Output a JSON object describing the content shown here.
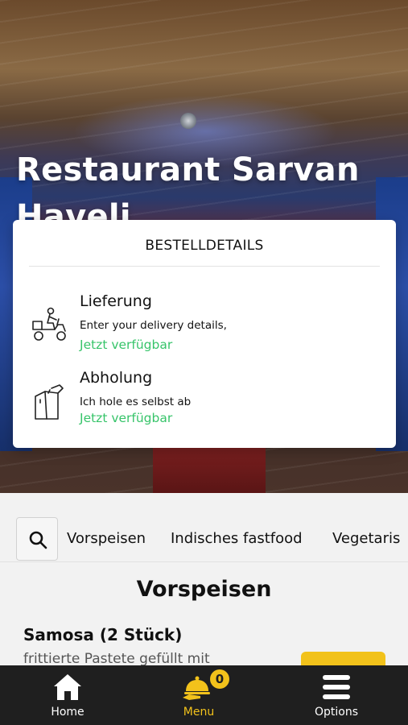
{
  "restaurant": {
    "name": "Restaurant Sarvan Haveli"
  },
  "order_modal": {
    "title": "BESTELLDETAILS",
    "options": [
      {
        "title": "Lieferung",
        "description": "Enter your delivery details,",
        "status": "Jetzt verfügbar",
        "icon": "delivery-scooter-icon"
      },
      {
        "title": "Abholung",
        "description": "Ich hole es selbst ab",
        "status": "Jetzt verfügbar",
        "icon": "takeaway-bag-icon"
      }
    ]
  },
  "categories": [
    "Vorspeisen",
    "Indisches fastfood",
    "Vegetaris"
  ],
  "menu": {
    "section_title": "Vorspeisen",
    "items": [
      {
        "name": "Samosa (2 Stück)",
        "description": "frittierte Pastete gefüllt mit"
      }
    ]
  },
  "bottom_nav": {
    "home": "Home",
    "menu": "Menu",
    "options": "Options",
    "cart_count": "0"
  },
  "colors": {
    "accent": "#f2c21b",
    "available": "#37c46a",
    "nav_background": "#1f1f1f"
  }
}
